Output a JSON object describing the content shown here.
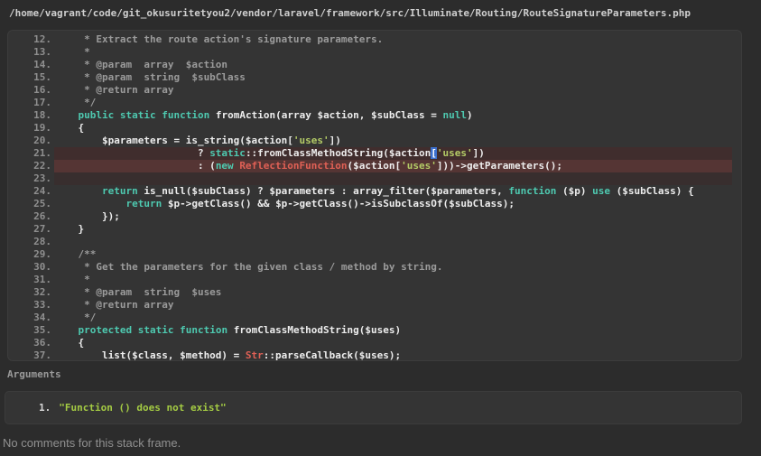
{
  "header": {
    "file_path": "/home/vagrant/code/git_okusuritetyou2/vendor/laravel/framework/src/Illuminate/Routing/RouteSignatureParameters.php"
  },
  "code": {
    "lines": [
      {
        "n": "12.",
        "hl": "",
        "seg": [
          [
            "c",
            "     * Extract the route action's signature parameters."
          ]
        ]
      },
      {
        "n": "13.",
        "hl": "",
        "seg": [
          [
            "c",
            "     *"
          ]
        ]
      },
      {
        "n": "14.",
        "hl": "",
        "seg": [
          [
            "c",
            "     * @param  array  $action"
          ]
        ]
      },
      {
        "n": "15.",
        "hl": "",
        "seg": [
          [
            "c",
            "     * @param  string  $subClass"
          ]
        ]
      },
      {
        "n": "16.",
        "hl": "",
        "seg": [
          [
            "c",
            "     * @return array"
          ]
        ]
      },
      {
        "n": "17.",
        "hl": "",
        "seg": [
          [
            "c",
            "     */"
          ]
        ]
      },
      {
        "n": "18.",
        "hl": "",
        "seg": [
          [
            "p",
            "    "
          ],
          [
            "k",
            "public"
          ],
          [
            "p",
            " "
          ],
          [
            "k",
            "static"
          ],
          [
            "p",
            " "
          ],
          [
            "k",
            "function"
          ],
          [
            "p",
            " fromAction(array $action, $subClass = "
          ],
          [
            "k",
            "null"
          ],
          [
            "p",
            ")"
          ]
        ]
      },
      {
        "n": "19.",
        "hl": "",
        "seg": [
          [
            "p",
            "    {"
          ]
        ]
      },
      {
        "n": "20.",
        "hl": "",
        "seg": [
          [
            "p",
            "        $parameters = is_string($action["
          ],
          [
            "s",
            "'uses'"
          ],
          [
            "p",
            "])"
          ]
        ]
      },
      {
        "n": "21.",
        "hl": "soft",
        "seg": [
          [
            "p",
            "                        ? "
          ],
          [
            "k",
            "static"
          ],
          [
            "p",
            "::fromClassMethodString($action"
          ],
          [
            "b",
            "["
          ],
          [
            "s",
            "'uses'"
          ],
          [
            "p",
            "])"
          ]
        ]
      },
      {
        "n": "22.",
        "hl": "strong",
        "seg": [
          [
            "p",
            "                        : ("
          ],
          [
            "k",
            "new"
          ],
          [
            "p",
            " "
          ],
          [
            "cl",
            "ReflectionFunction"
          ],
          [
            "p",
            "($action["
          ],
          [
            "s",
            "'uses'"
          ],
          [
            "p",
            "]))->getParameters();"
          ]
        ]
      },
      {
        "n": "23.",
        "hl": "faint",
        "seg": []
      },
      {
        "n": "24.",
        "hl": "",
        "seg": [
          [
            "p",
            "        "
          ],
          [
            "k",
            "return"
          ],
          [
            "p",
            " is_null($subClass) ? $parameters : array_filter($parameters, "
          ],
          [
            "k",
            "function"
          ],
          [
            "p",
            " ($p) "
          ],
          [
            "k",
            "use"
          ],
          [
            "p",
            " ($subClass) {"
          ]
        ]
      },
      {
        "n": "25.",
        "hl": "",
        "seg": [
          [
            "p",
            "            "
          ],
          [
            "k",
            "return"
          ],
          [
            "p",
            " $p->getClass() && $p->getClass()->isSubclassOf($subClass);"
          ]
        ]
      },
      {
        "n": "26.",
        "hl": "",
        "seg": [
          [
            "p",
            "        });"
          ]
        ]
      },
      {
        "n": "27.",
        "hl": "",
        "seg": [
          [
            "p",
            "    }"
          ]
        ]
      },
      {
        "n": "28.",
        "hl": "",
        "seg": []
      },
      {
        "n": "29.",
        "hl": "",
        "seg": [
          [
            "c",
            "    /**"
          ]
        ]
      },
      {
        "n": "30.",
        "hl": "",
        "seg": [
          [
            "c",
            "     * Get the parameters for the given class / method by string."
          ]
        ]
      },
      {
        "n": "31.",
        "hl": "",
        "seg": [
          [
            "c",
            "     *"
          ]
        ]
      },
      {
        "n": "32.",
        "hl": "",
        "seg": [
          [
            "c",
            "     * @param  string  $uses"
          ]
        ]
      },
      {
        "n": "33.",
        "hl": "",
        "seg": [
          [
            "c",
            "     * @return array"
          ]
        ]
      },
      {
        "n": "34.",
        "hl": "",
        "seg": [
          [
            "c",
            "     */"
          ]
        ]
      },
      {
        "n": "35.",
        "hl": "",
        "seg": [
          [
            "p",
            "    "
          ],
          [
            "k",
            "protected"
          ],
          [
            "p",
            " "
          ],
          [
            "k",
            "static"
          ],
          [
            "p",
            " "
          ],
          [
            "k",
            "function"
          ],
          [
            "p",
            " fromClassMethodString($uses)"
          ]
        ]
      },
      {
        "n": "36.",
        "hl": "",
        "seg": [
          [
            "p",
            "    {"
          ]
        ]
      },
      {
        "n": "37.",
        "hl": "",
        "seg": [
          [
            "p",
            "        list($class, $method) = "
          ],
          [
            "cl",
            "Str"
          ],
          [
            "p",
            "::parseCallback($uses);"
          ]
        ]
      }
    ]
  },
  "arguments": {
    "label": "Arguments",
    "items": [
      {
        "index": "1.",
        "value": "\"Function () does not exist\""
      }
    ]
  },
  "footer": {
    "comments_text": "No comments for this stack frame."
  },
  "colors": {
    "page_bg": "#2c2c2c",
    "panel_bg": "#343434",
    "keyword": "#4ec9b0",
    "string": "#b3cb66",
    "class_name": "#e06055",
    "comment": "#9b9b9b",
    "plain": "#ededed",
    "line_number": "#8f8f8f",
    "highlight_soft": "#402d2d",
    "highlight_strong": "#553534",
    "bracket_match_bg": "#3c70cc",
    "argument_string": "#a4cb43"
  }
}
